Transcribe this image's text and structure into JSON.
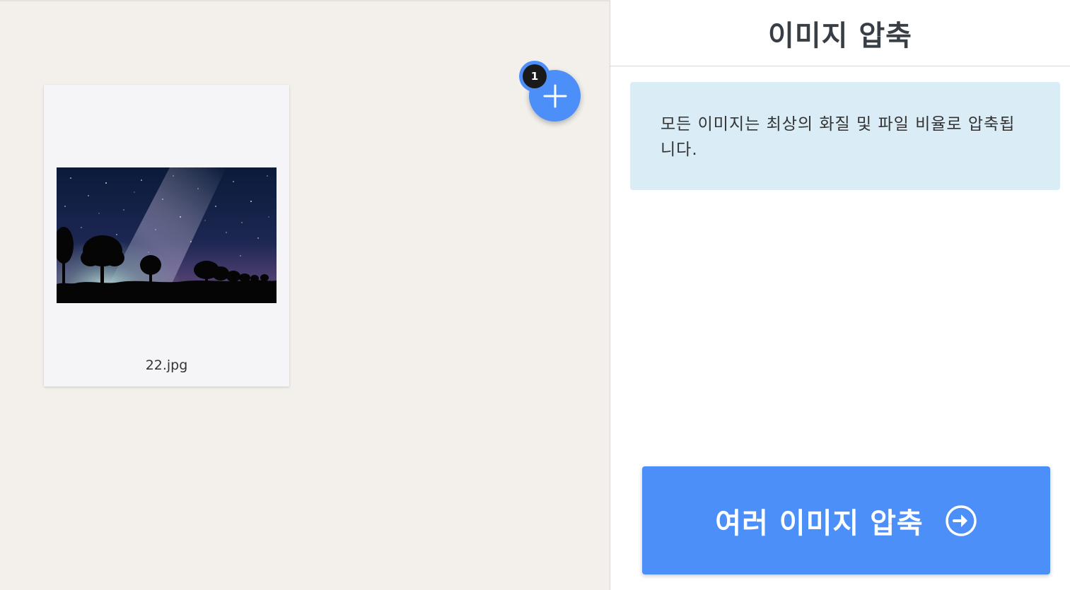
{
  "files": [
    {
      "name": "22.jpg"
    }
  ],
  "add_button": {
    "icon": "plus-icon",
    "count": "1"
  },
  "sidebar": {
    "title": "이미지 압축",
    "info": "모든 이미지는 최상의 화질 및 파일 비율로 압축됩니다.",
    "compress_button": {
      "label": "여러 이미지 압축",
      "icon": "arrow-right-circle-icon"
    }
  },
  "colors": {
    "accent": "#4d8ff9",
    "workspace_bg": "#f3f0ec",
    "info_bg": "#daecf5",
    "title_text": "#383e45"
  }
}
